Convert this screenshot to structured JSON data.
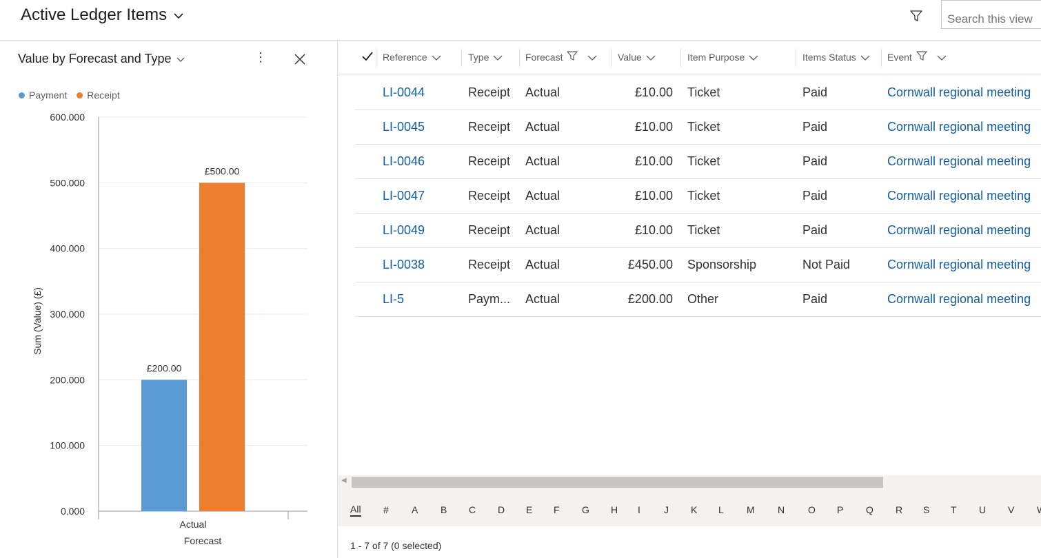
{
  "header": {
    "title": "Active Ledger Items",
    "search_placeholder": "Search this view"
  },
  "chart_panel": {
    "title": "Value by Forecast and Type",
    "more_label": "⋮"
  },
  "colors": {
    "payment": "#5b9bd5",
    "receipt": "#ed7d31",
    "link": "#115ea3"
  },
  "chart_data": {
    "type": "bar",
    "categories": [
      "Actual"
    ],
    "series": [
      {
        "name": "Payment",
        "values": [
          200
        ],
        "label": "£200.00"
      },
      {
        "name": "Receipt",
        "values": [
          500
        ],
        "label": "£500.00"
      }
    ],
    "ylim": [
      0,
      600
    ],
    "yticks": [
      "0.000",
      "100.000",
      "200.000",
      "300.000",
      "400.000",
      "500.000",
      "600.000"
    ],
    "xlabel": "Forecast",
    "ylabel": "Sum (Value) (£)",
    "legend": "top-left",
    "grid": true
  },
  "grid": {
    "columns": [
      "Reference",
      "Type",
      "Forecast",
      "Value",
      "Item Purpose",
      "Items Status",
      "Event"
    ],
    "rows": [
      {
        "reference": "LI-0044",
        "type": "Receipt",
        "forecast": "Actual",
        "value": "£10.00",
        "purpose": "Ticket",
        "status": "Paid",
        "event": "Cornwall regional meeting"
      },
      {
        "reference": "LI-0045",
        "type": "Receipt",
        "forecast": "Actual",
        "value": "£10.00",
        "purpose": "Ticket",
        "status": "Paid",
        "event": "Cornwall regional meeting"
      },
      {
        "reference": "LI-0046",
        "type": "Receipt",
        "forecast": "Actual",
        "value": "£10.00",
        "purpose": "Ticket",
        "status": "Paid",
        "event": "Cornwall regional meeting"
      },
      {
        "reference": "LI-0047",
        "type": "Receipt",
        "forecast": "Actual",
        "value": "£10.00",
        "purpose": "Ticket",
        "status": "Paid",
        "event": "Cornwall regional meeting"
      },
      {
        "reference": "LI-0049",
        "type": "Receipt",
        "forecast": "Actual",
        "value": "£10.00",
        "purpose": "Ticket",
        "status": "Paid",
        "event": "Cornwall regional meeting"
      },
      {
        "reference": "LI-0038",
        "type": "Receipt",
        "forecast": "Actual",
        "value": "£450.00",
        "purpose": "Sponsorship",
        "status": "Not Paid",
        "event": "Cornwall regional meeting"
      },
      {
        "reference": "LI-5",
        "type": "Paym...",
        "forecast": "Actual",
        "value": "£200.00",
        "purpose": "Other",
        "status": "Paid",
        "event": "Cornwall regional meeting"
      }
    ]
  },
  "jump_letters": [
    "All",
    "#",
    "A",
    "B",
    "C",
    "D",
    "E",
    "F",
    "G",
    "H",
    "I",
    "J",
    "K",
    "L",
    "M",
    "N",
    "O",
    "P",
    "Q",
    "R",
    "S",
    "T",
    "U",
    "V",
    "W"
  ],
  "footer": {
    "summary": "1 - 7 of 7 (0 selected)"
  }
}
